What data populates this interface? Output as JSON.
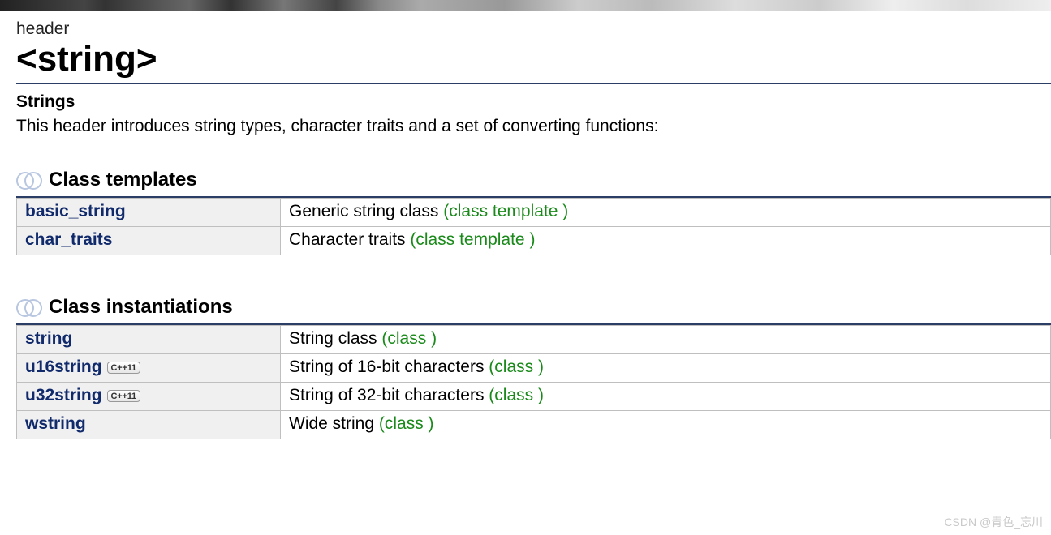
{
  "header": {
    "label": "header",
    "title": "<string>",
    "subhead": "Strings",
    "description": "This header introduces string types, character traits and a set of converting functions:"
  },
  "sections": {
    "templates": {
      "title": "Class templates",
      "rows": [
        {
          "name": "basic_string",
          "desc": "Generic string class",
          "tag": "(class template )",
          "badge": null
        },
        {
          "name": "char_traits",
          "desc": "Character traits",
          "tag": "(class template )",
          "badge": null
        }
      ]
    },
    "instantiations": {
      "title": "Class instantiations",
      "rows": [
        {
          "name": "string",
          "desc": "String class",
          "tag": "(class )",
          "badge": null
        },
        {
          "name": "u16string",
          "desc": "String of 16-bit characters",
          "tag": "(class )",
          "badge": "C++11"
        },
        {
          "name": "u32string",
          "desc": "String of 32-bit characters",
          "tag": "(class )",
          "badge": "C++11"
        },
        {
          "name": "wstring",
          "desc": "Wide string",
          "tag": "(class )",
          "badge": null
        }
      ]
    }
  },
  "watermark": "CSDN @青色_忘川"
}
